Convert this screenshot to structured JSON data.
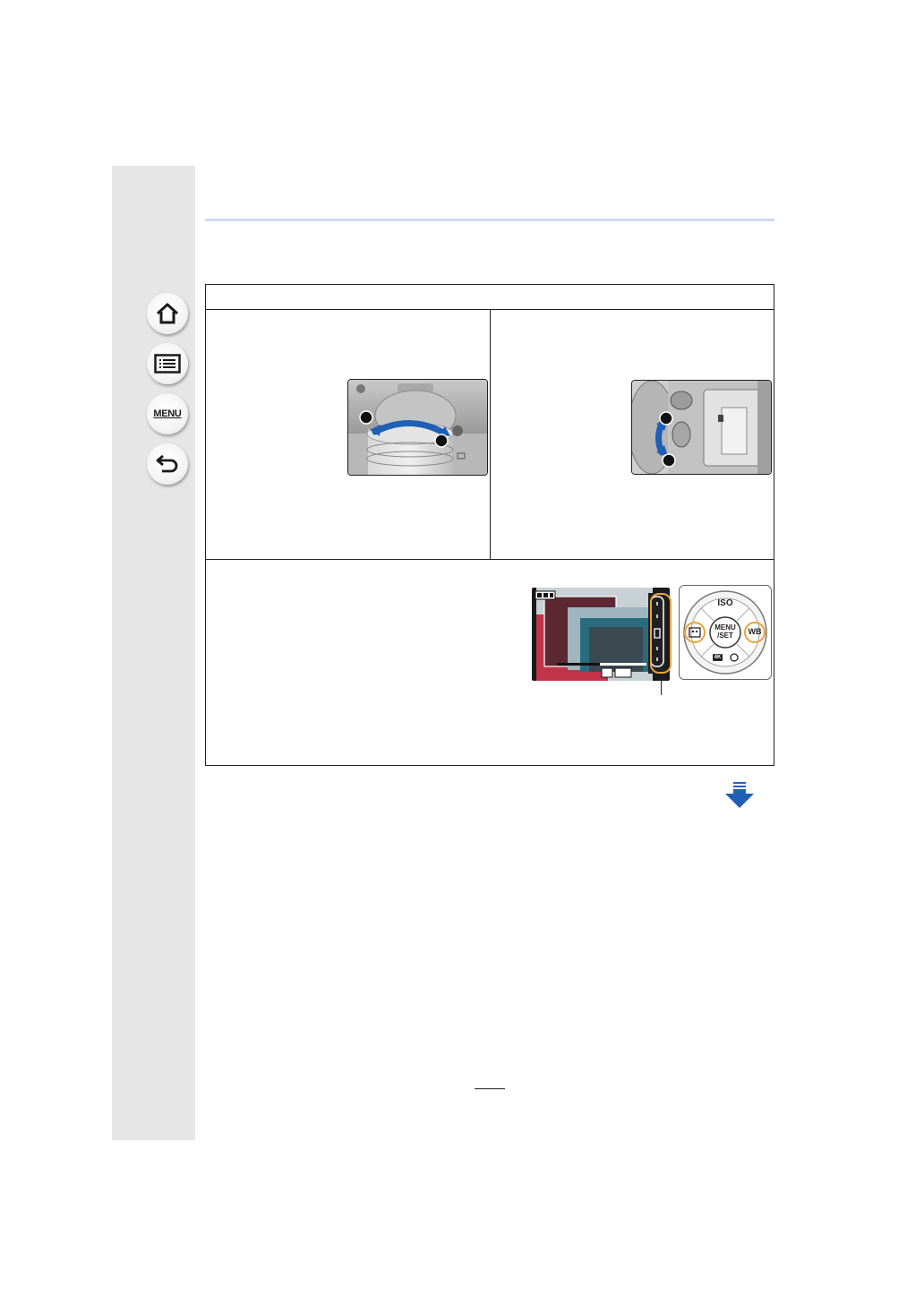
{
  "sidebar": {
    "buttons": [
      {
        "icon": "home-icon"
      },
      {
        "icon": "contents-list-icon"
      },
      {
        "icon": "menu-icon",
        "label": "MENU"
      },
      {
        "icon": "back-icon"
      }
    ]
  },
  "illustrations": {
    "focus_ring": {
      "callouts": [
        "",
        ""
      ]
    },
    "focus_lever": {
      "callouts": [
        "",
        ""
      ]
    },
    "zoom_screen": {
      "badge": "",
      "scale_marks": [
        "",
        "",
        "",
        "",
        ""
      ]
    },
    "control_dial": {
      "top_label": "ISO",
      "center_label_line1": "MENU",
      "center_label_line2": "/SET",
      "right_label": "WB",
      "bottom_label": "4K",
      "highlight_color": "#e8a33a"
    }
  },
  "colors": {
    "sidebar": "#e6e6e6",
    "rule": "#cfdcef",
    "accent_blue": "#1f5fb5",
    "highlight": "#e8a33a"
  },
  "navigation": {
    "next_page_icon": "next-page-arrow-icon"
  }
}
